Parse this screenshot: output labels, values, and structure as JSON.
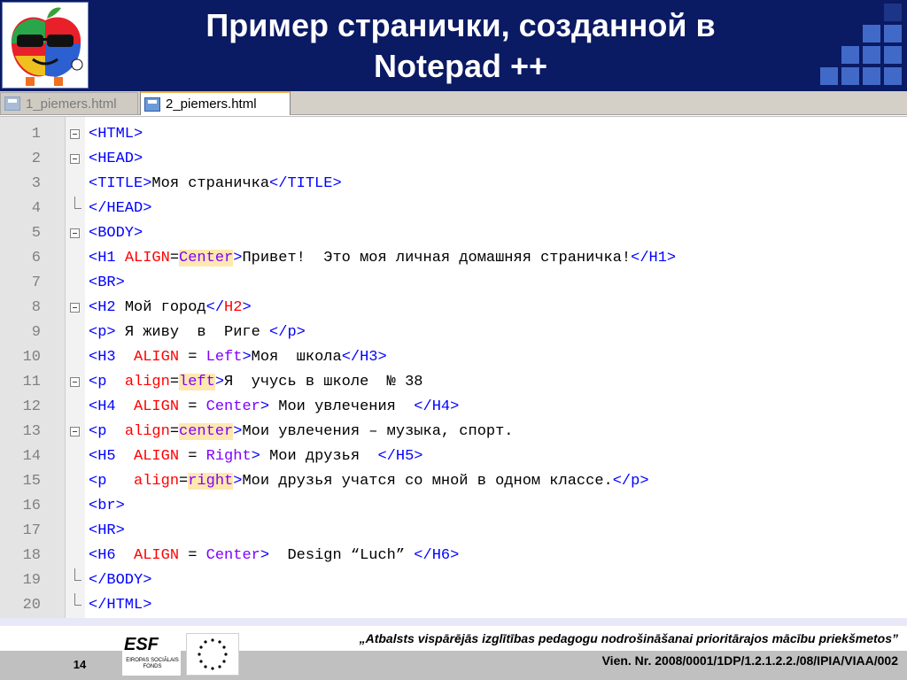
{
  "slide": {
    "title_line1": "Пример странички, созданной в",
    "title_line2": "Notepad ++",
    "number": "14"
  },
  "tabs": [
    {
      "label": "1_piemers.html",
      "active": false
    },
    {
      "label": "2_piemers.html",
      "active": true
    }
  ],
  "lines": [
    {
      "n": "1",
      "fold": "open",
      "tokens": [
        [
          "tg",
          "<HTML>"
        ]
      ]
    },
    {
      "n": "2",
      "fold": "open",
      "tokens": [
        [
          "tg",
          "<HEAD>"
        ]
      ]
    },
    {
      "n": "3",
      "fold": "none",
      "tokens": [
        [
          "tg",
          "<TITLE>"
        ],
        [
          "tx",
          "Моя страничка"
        ],
        [
          "tg",
          "</TITLE>"
        ]
      ]
    },
    {
      "n": "4",
      "fold": "end",
      "tokens": [
        [
          "tg",
          "</HEAD>"
        ]
      ]
    },
    {
      "n": "5",
      "fold": "open",
      "tokens": [
        [
          "tg",
          "<BODY>"
        ]
      ]
    },
    {
      "n": "6",
      "fold": "none",
      "tokens": [
        [
          "tg",
          "<H1 "
        ],
        [
          "at",
          "ALIGN"
        ],
        [
          "eq",
          "="
        ],
        [
          "vlh",
          "Center"
        ],
        [
          "tg",
          ">"
        ],
        [
          "tx",
          "Привет!  Это моя личная домашняя страничка!"
        ],
        [
          "tg",
          "</H1>"
        ]
      ]
    },
    {
      "n": "7",
      "fold": "none",
      "tokens": [
        [
          "tg",
          "<BR>"
        ]
      ]
    },
    {
      "n": "8",
      "fold": "open",
      "tokens": [
        [
          "tg",
          "<H2 "
        ],
        [
          "tx",
          "Мой город"
        ],
        [
          "tg",
          "</"
        ],
        [
          "at",
          "H2"
        ],
        [
          "tg",
          ">"
        ]
      ]
    },
    {
      "n": "9",
      "fold": "none",
      "tokens": [
        [
          "tg",
          "<p> "
        ],
        [
          "tx",
          "Я живу  в  Риге "
        ],
        [
          "tg",
          "</p>"
        ]
      ]
    },
    {
      "n": "10",
      "fold": "none",
      "tokens": [
        [
          "tg",
          "<H3  "
        ],
        [
          "at",
          "ALIGN"
        ],
        [
          "eq",
          " = "
        ],
        [
          "vl",
          "Left"
        ],
        [
          "tg",
          ">"
        ],
        [
          "tx",
          "Моя  школа"
        ],
        [
          "tg",
          "</H3>"
        ]
      ]
    },
    {
      "n": "11",
      "fold": "open",
      "tokens": [
        [
          "tg",
          "<p  "
        ],
        [
          "at",
          "align"
        ],
        [
          "eq",
          "="
        ],
        [
          "vlh",
          "left"
        ],
        [
          "tg",
          ">"
        ],
        [
          "tx",
          "Я  учусь в школе  № 38"
        ]
      ]
    },
    {
      "n": "12",
      "fold": "none",
      "tokens": [
        [
          "tg",
          "<H4  "
        ],
        [
          "at",
          "ALIGN"
        ],
        [
          "eq",
          " = "
        ],
        [
          "vl",
          "Center"
        ],
        [
          "tg",
          "> "
        ],
        [
          "tx",
          "Мои увлечения  "
        ],
        [
          "tg",
          "</H4>"
        ]
      ]
    },
    {
      "n": "13",
      "fold": "open",
      "tokens": [
        [
          "tg",
          "<p  "
        ],
        [
          "at",
          "align"
        ],
        [
          "eq",
          "="
        ],
        [
          "vlh",
          "center"
        ],
        [
          "tg",
          ">"
        ],
        [
          "tx",
          "Мои увлечения – музыка, спорт."
        ]
      ]
    },
    {
      "n": "14",
      "fold": "none",
      "tokens": [
        [
          "tg",
          "<H5  "
        ],
        [
          "at",
          "ALIGN"
        ],
        [
          "eq",
          " = "
        ],
        [
          "vl",
          "Right"
        ],
        [
          "tg",
          "> "
        ],
        [
          "tx",
          "Мои друзья  "
        ],
        [
          "tg",
          "</H5>"
        ]
      ]
    },
    {
      "n": "15",
      "fold": "none",
      "tokens": [
        [
          "tg",
          "<p   "
        ],
        [
          "at",
          "align"
        ],
        [
          "eq",
          "="
        ],
        [
          "vlh",
          "right"
        ],
        [
          "tg",
          ">"
        ],
        [
          "tx",
          "Мои друзья учатся со мной в одном классе."
        ],
        [
          "tg",
          "</p>"
        ]
      ]
    },
    {
      "n": "16",
      "fold": "none",
      "tokens": [
        [
          "tg",
          "<br>"
        ]
      ]
    },
    {
      "n": "17",
      "fold": "none",
      "tokens": [
        [
          "tg",
          "<HR>"
        ]
      ]
    },
    {
      "n": "18",
      "fold": "none",
      "tokens": [
        [
          "tg",
          "<H6  "
        ],
        [
          "at",
          "ALIGN"
        ],
        [
          "eq",
          " = "
        ],
        [
          "vl",
          "Center"
        ],
        [
          "tg",
          ">  "
        ],
        [
          "tx",
          "Design “Luch” "
        ],
        [
          "tg",
          "</H6>"
        ]
      ]
    },
    {
      "n": "19",
      "fold": "end",
      "tokens": [
        [
          "tg",
          "</BODY>"
        ]
      ]
    },
    {
      "n": "20",
      "fold": "end",
      "tokens": [
        [
          "tg",
          "</HTML>"
        ]
      ]
    }
  ],
  "footer": {
    "esf_mark": "ESF",
    "esf_sub": "EIROPAS SOCIĀLAIS FONDS",
    "line1": "„Atbalsts vispārējās izglītības pedagogu nodrošināšanai prioritārajos mācību priekšmetos”",
    "line2": "Vien. Nr. 2008/0001/1DP/1.2.1.2.2./08/IPIA/VIAA/002"
  },
  "colors": {
    "header_bg": "#0a1a63",
    "tag": "#0000ff",
    "attribute": "#ff0000",
    "value": "#8000ff",
    "value_highlight": "#ffe8b0"
  },
  "icons": [
    "apple-mascot-logo",
    "disk-icon",
    "fold-open-icon",
    "fold-end-icon",
    "esf-logo",
    "eu-flag"
  ]
}
